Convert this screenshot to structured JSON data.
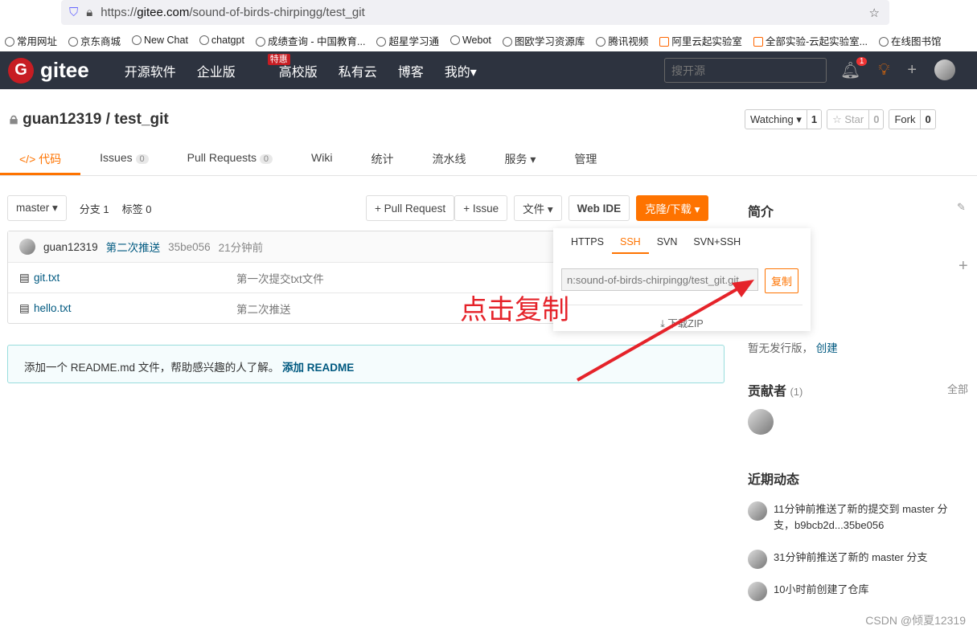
{
  "browser": {
    "url_prefix": "https://",
    "url_domain": "gitee.com",
    "url_path": "/sound-of-birds-chirpingg/test_git",
    "bookmarks": [
      "常用网址",
      "京东商城",
      "New Chat",
      "chatgpt",
      "成绩查询 - 中国教育...",
      "超星学习通",
      "Webot",
      "图欧学习资源库",
      "腾讯视频",
      "阿里云起实验室",
      "全部实验-云起实验室...",
      "在线图书馆"
    ]
  },
  "nav": {
    "logo": "gitee",
    "logo_letter": "G",
    "items": [
      "开源软件",
      "企业版",
      "高校版",
      "私有云",
      "博客",
      "我的▾"
    ],
    "hot_badge": "特惠",
    "search_placeholder": "搜开源",
    "notif_count": "1"
  },
  "repo": {
    "title": "guan12319 / test_git",
    "watch": "Watching ▾",
    "watch_count": "1",
    "star": "☆ Star",
    "star_count": "0",
    "fork": "Fork",
    "fork_count": "0"
  },
  "tabs": [
    {
      "label": "</> 代码"
    },
    {
      "label": "Issues",
      "count": "0"
    },
    {
      "label": "Pull Requests",
      "count": "0"
    },
    {
      "label": "Wiki"
    },
    {
      "label": "统计"
    },
    {
      "label": "流水线"
    },
    {
      "label": "服务 ▾"
    },
    {
      "label": "管理"
    }
  ],
  "toolbar": {
    "branch": "master ▾",
    "branches": "分支 1",
    "tags": "标签 0",
    "pull_request": "+ Pull Request",
    "issue": "+ Issue",
    "file": "文件 ▾",
    "web_ide": "Web IDE",
    "clone": "克隆/下载 ▾"
  },
  "commit": {
    "author": "guan12319",
    "message": "第二次推送",
    "hash": "35be056",
    "time": "21分钟前"
  },
  "files": [
    {
      "name": "git.txt",
      "msg": "第一次提交txt文件"
    },
    {
      "name": "hello.txt",
      "msg": "第二次推送"
    }
  ],
  "readme": {
    "text": "添加一个 README.md 文件，帮助感兴趣的人了解。",
    "link": "添加 README"
  },
  "clone_panel": {
    "tabs": [
      "HTTPS",
      "SSH",
      "SVN",
      "SVN+SSH"
    ],
    "active": "SSH",
    "url": "n:sound-of-birds-chirpingg/test_git.git",
    "copy": "复制",
    "zip": "下载ZIP"
  },
  "annotation": "点击复制",
  "sidebar": {
    "intro": "简介",
    "release_text": "暂无发行版，",
    "release_link": "创建",
    "contributors": "贡献者",
    "contributors_count": "(1)",
    "all": "全部",
    "activity_title": "近期动态",
    "activity": [
      "11分钟前推送了新的提交到 master 分支，b9bcb2d...35be056",
      "31分钟前推送了新的 master 分支",
      "10小时前创建了仓库"
    ]
  },
  "watermark": "CSDN @倾夏12319"
}
